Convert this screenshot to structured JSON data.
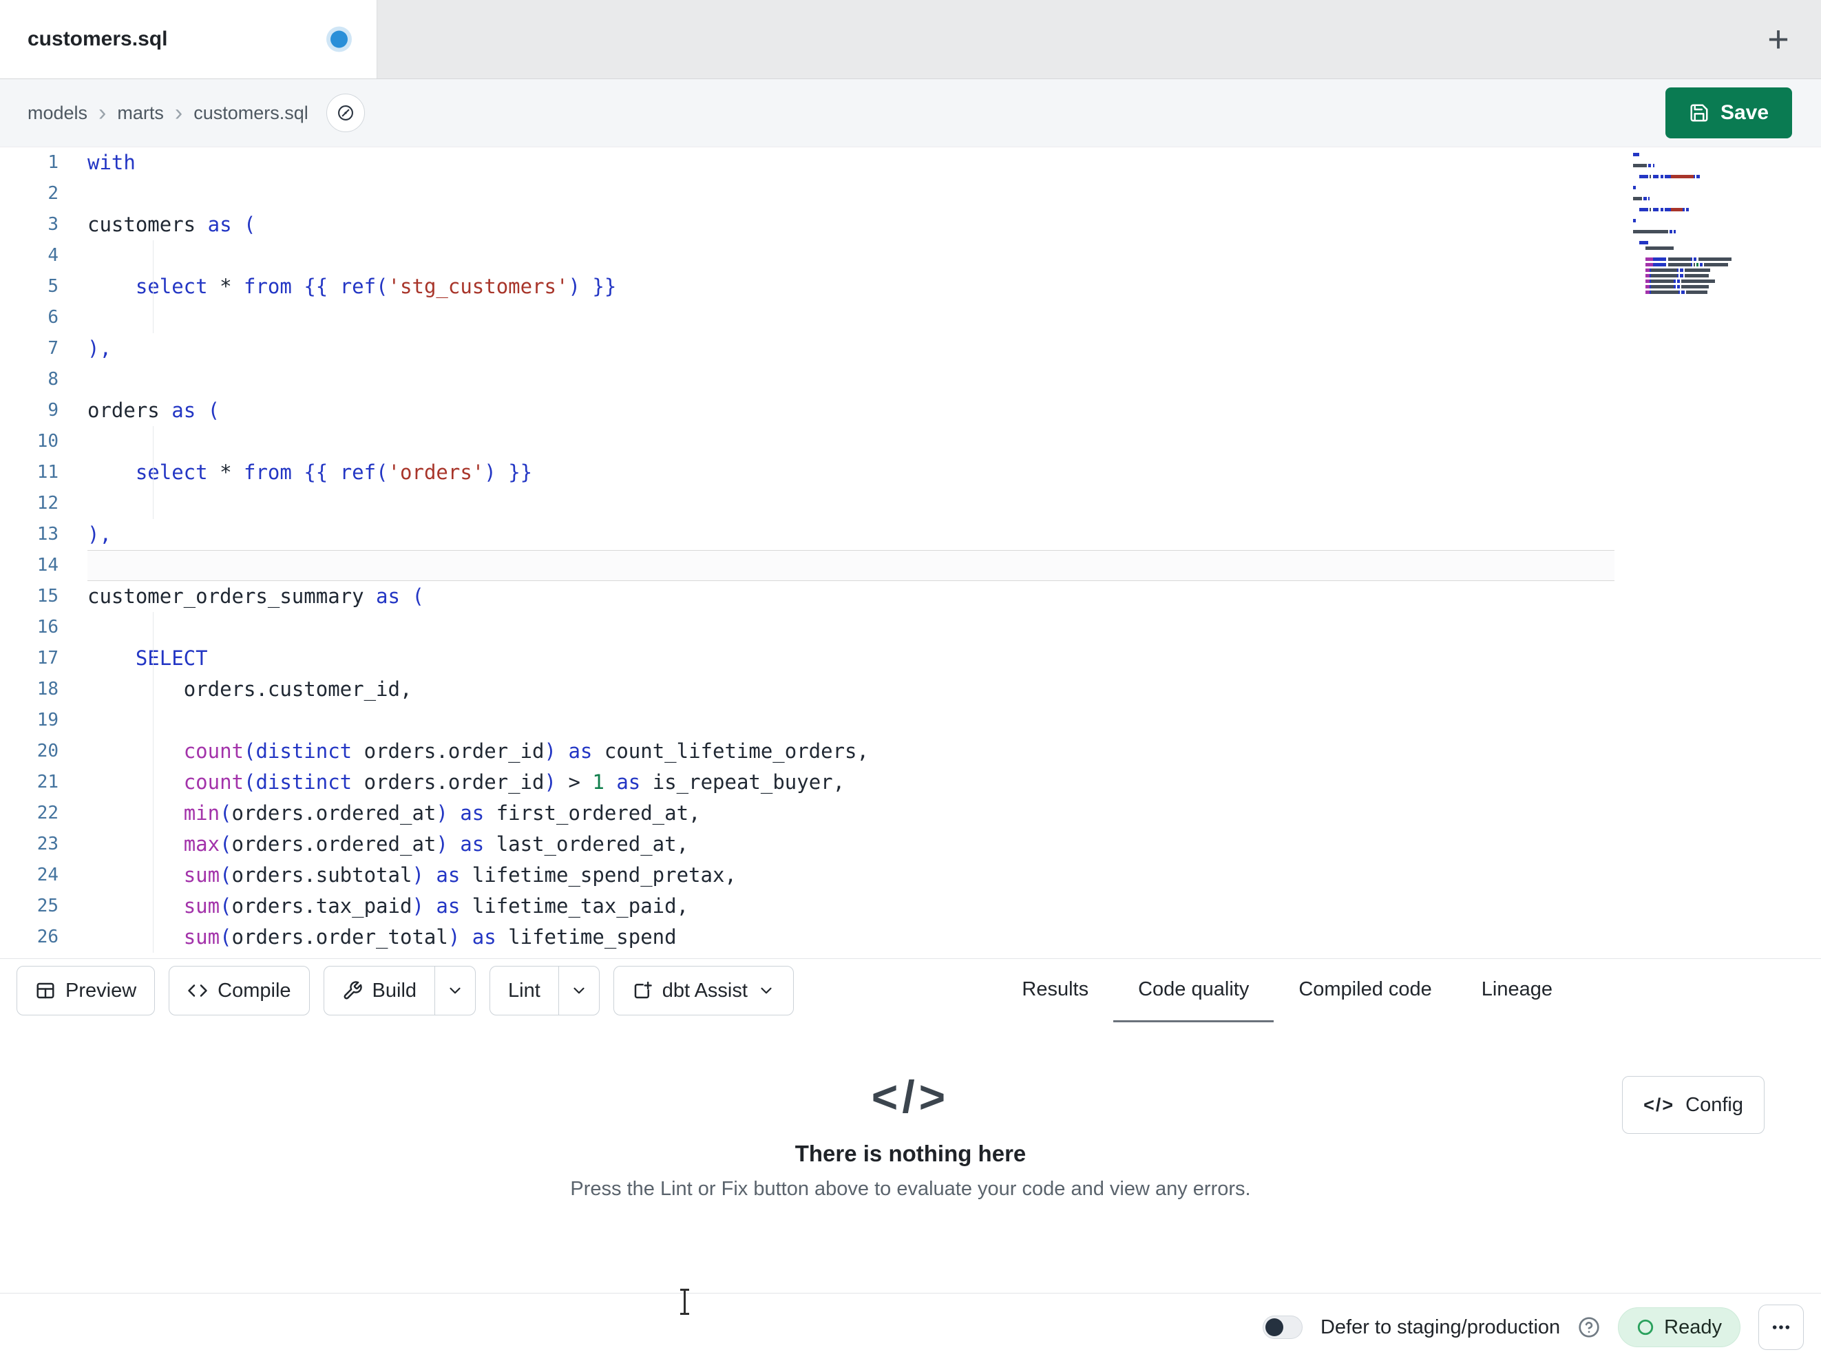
{
  "window": {
    "tab_title": "customers.sql",
    "new_tab_glyph": "+"
  },
  "breadcrumb": {
    "items": [
      "models",
      "marts",
      "customers.sql"
    ],
    "separator": "›"
  },
  "save": {
    "label": "Save"
  },
  "editor": {
    "current_line": 14,
    "lines": [
      [
        [
          "kw",
          "with"
        ]
      ],
      [],
      [
        [
          "txt",
          "customers"
        ],
        [
          "ws",
          " "
        ],
        [
          "kw",
          "as"
        ],
        [
          "ws",
          " "
        ],
        [
          "pun",
          "("
        ]
      ],
      [],
      [
        [
          "ws",
          "    "
        ],
        [
          "kw",
          "select"
        ],
        [
          "ws",
          " "
        ],
        [
          "txt",
          "*"
        ],
        [
          "ws",
          " "
        ],
        [
          "kw",
          "from"
        ],
        [
          "ws",
          " "
        ],
        [
          "pun",
          "{{"
        ],
        [
          "ws",
          " "
        ],
        [
          "kw",
          "ref"
        ],
        [
          "pun",
          "("
        ],
        [
          "str",
          "'stg_customers'"
        ],
        [
          "pun",
          ")"
        ],
        [
          "ws",
          " "
        ],
        [
          "pun",
          "}}"
        ]
      ],
      [],
      [
        [
          "pun",
          "),"
        ]
      ],
      [],
      [
        [
          "txt",
          "orders"
        ],
        [
          "ws",
          " "
        ],
        [
          "kw",
          "as"
        ],
        [
          "ws",
          " "
        ],
        [
          "pun",
          "("
        ]
      ],
      [],
      [
        [
          "ws",
          "    "
        ],
        [
          "kw",
          "select"
        ],
        [
          "ws",
          " "
        ],
        [
          "txt",
          "*"
        ],
        [
          "ws",
          " "
        ],
        [
          "kw",
          "from"
        ],
        [
          "ws",
          " "
        ],
        [
          "pun",
          "{{"
        ],
        [
          "ws",
          " "
        ],
        [
          "kw",
          "ref"
        ],
        [
          "pun",
          "("
        ],
        [
          "str",
          "'orders'"
        ],
        [
          "pun",
          ")"
        ],
        [
          "ws",
          " "
        ],
        [
          "pun",
          "}}"
        ]
      ],
      [],
      [
        [
          "pun",
          "),"
        ]
      ],
      [],
      [
        [
          "txt",
          "customer_orders_summary"
        ],
        [
          "ws",
          " "
        ],
        [
          "kw",
          "as"
        ],
        [
          "ws",
          " "
        ],
        [
          "pun",
          "("
        ]
      ],
      [],
      [
        [
          "ws",
          "    "
        ],
        [
          "kw",
          "SELECT"
        ]
      ],
      [
        [
          "ws",
          "        "
        ],
        [
          "txt",
          "orders.customer_id,"
        ]
      ],
      [],
      [
        [
          "ws",
          "        "
        ],
        [
          "fn",
          "count"
        ],
        [
          "pun",
          "("
        ],
        [
          "kw",
          "distinct"
        ],
        [
          "ws",
          " "
        ],
        [
          "txt",
          "orders.order_id"
        ],
        [
          "pun",
          ")"
        ],
        [
          "ws",
          " "
        ],
        [
          "kw",
          "as"
        ],
        [
          "ws",
          " "
        ],
        [
          "txt",
          "count_lifetime_orders,"
        ]
      ],
      [
        [
          "ws",
          "        "
        ],
        [
          "fn",
          "count"
        ],
        [
          "pun",
          "("
        ],
        [
          "kw",
          "distinct"
        ],
        [
          "ws",
          " "
        ],
        [
          "txt",
          "orders.order_id"
        ],
        [
          "pun",
          ")"
        ],
        [
          "ws",
          " "
        ],
        [
          "txt",
          ">"
        ],
        [
          "ws",
          " "
        ],
        [
          "num",
          "1"
        ],
        [
          "ws",
          " "
        ],
        [
          "kw",
          "as"
        ],
        [
          "ws",
          " "
        ],
        [
          "txt",
          "is_repeat_buyer,"
        ]
      ],
      [
        [
          "ws",
          "        "
        ],
        [
          "fn",
          "min"
        ],
        [
          "pun",
          "("
        ],
        [
          "txt",
          "orders.ordered_at"
        ],
        [
          "pun",
          ")"
        ],
        [
          "ws",
          " "
        ],
        [
          "kw",
          "as"
        ],
        [
          "ws",
          " "
        ],
        [
          "txt",
          "first_ordered_at,"
        ]
      ],
      [
        [
          "ws",
          "        "
        ],
        [
          "fn",
          "max"
        ],
        [
          "pun",
          "("
        ],
        [
          "txt",
          "orders.ordered_at"
        ],
        [
          "pun",
          ")"
        ],
        [
          "ws",
          " "
        ],
        [
          "kw",
          "as"
        ],
        [
          "ws",
          " "
        ],
        [
          "txt",
          "last_ordered_at,"
        ]
      ],
      [
        [
          "ws",
          "        "
        ],
        [
          "fn",
          "sum"
        ],
        [
          "pun",
          "("
        ],
        [
          "txt",
          "orders.subtotal"
        ],
        [
          "pun",
          ")"
        ],
        [
          "ws",
          " "
        ],
        [
          "kw",
          "as"
        ],
        [
          "ws",
          " "
        ],
        [
          "txt",
          "lifetime_spend_pretax,"
        ]
      ],
      [
        [
          "ws",
          "        "
        ],
        [
          "fn",
          "sum"
        ],
        [
          "pun",
          "("
        ],
        [
          "txt",
          "orders.tax_paid"
        ],
        [
          "pun",
          ")"
        ],
        [
          "ws",
          " "
        ],
        [
          "kw",
          "as"
        ],
        [
          "ws",
          " "
        ],
        [
          "txt",
          "lifetime_tax_paid,"
        ]
      ],
      [
        [
          "ws",
          "        "
        ],
        [
          "fn",
          "sum"
        ],
        [
          "pun",
          "("
        ],
        [
          "txt",
          "orders.order_total"
        ],
        [
          "pun",
          ")"
        ],
        [
          "ws",
          " "
        ],
        [
          "kw",
          "as"
        ],
        [
          "ws",
          " "
        ],
        [
          "txt",
          "lifetime_spend"
        ]
      ]
    ]
  },
  "toolbar": {
    "preview_label": "Preview",
    "compile_label": "Compile",
    "build_label": "Build",
    "lint_label": "Lint",
    "assist_label": "dbt Assist"
  },
  "panel": {
    "tabs": [
      "Results",
      "Code quality",
      "Compiled code",
      "Lineage"
    ],
    "active_tab": "Code quality",
    "empty_icon": "</>",
    "empty_title": "There is nothing here",
    "empty_subtitle": "Press the Lint or Fix button above to evaluate your code and view any errors.",
    "config_icon": "</>",
    "config_label": "Config"
  },
  "statusbar": {
    "defer_label": "Defer to staging/production",
    "ready_label": "Ready"
  },
  "colors": {
    "save_green": "#0a7b52",
    "keyword_blue": "#2336c4",
    "function_purple": "#a333aa",
    "string_red": "#a8352a",
    "number_green": "#0e7d4a",
    "line_number_blue": "#44739e",
    "ready_badge_bg": "#def3e6",
    "ready_icon_green": "#2aa15d",
    "unsaved_dot_blue": "#2a8fd8"
  }
}
